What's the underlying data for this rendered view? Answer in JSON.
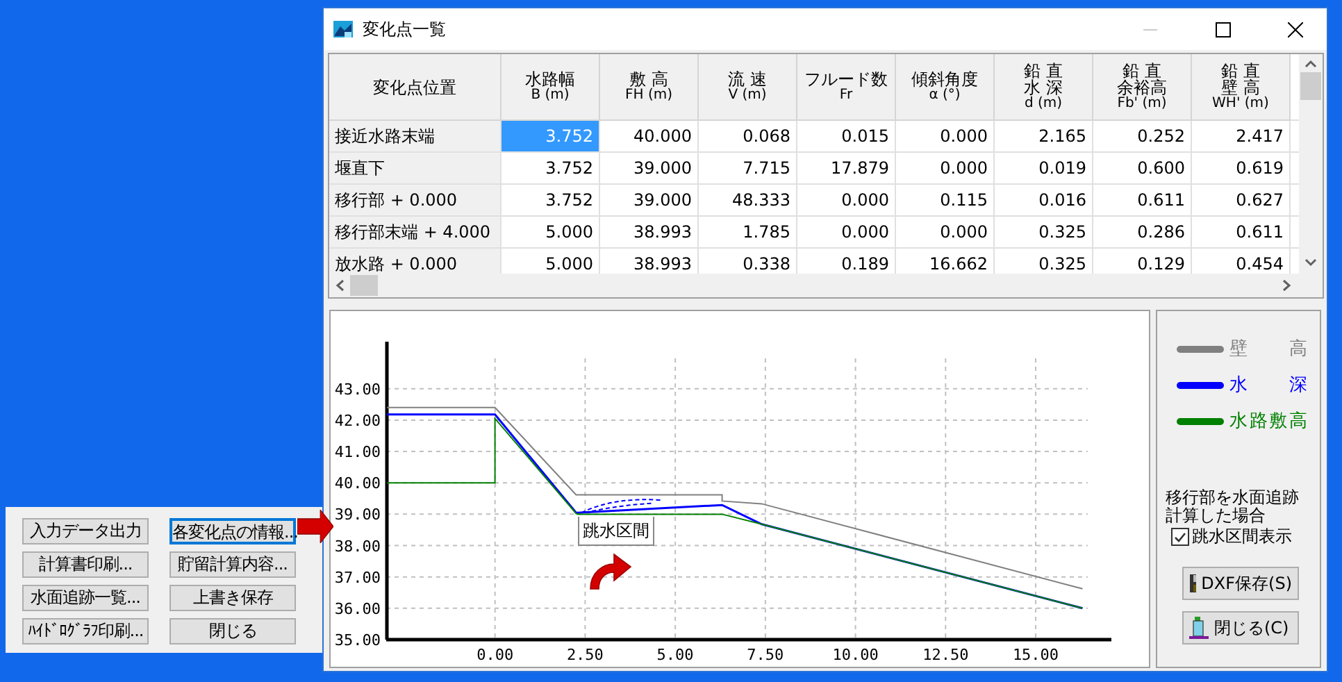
{
  "window": {
    "title": "変化点一覧"
  },
  "table": {
    "columns": [
      {
        "lines": [
          "変化点位置"
        ]
      },
      {
        "lines": [
          "水路幅",
          "B (m)"
        ]
      },
      {
        "lines": [
          "敷 高",
          "FH (m)"
        ]
      },
      {
        "lines": [
          "流 速",
          "V (m)"
        ]
      },
      {
        "lines": [
          "フルード数",
          "Fr"
        ]
      },
      {
        "lines": [
          "傾斜角度",
          "α (°)"
        ]
      },
      {
        "lines": [
          "鉛 直",
          "水 深",
          "d (m)"
        ]
      },
      {
        "lines": [
          "鉛 直",
          "余裕高",
          "Fb' (m)"
        ]
      },
      {
        "lines": [
          "鉛 直",
          "壁 高",
          "WH' (m)"
        ]
      }
    ],
    "rows": [
      {
        "cells": [
          {
            "text": "接近水路末端",
            "selected": false
          },
          {
            "text": "3.752",
            "selected": true
          },
          {
            "text": "40.000",
            "selected": false
          },
          {
            "text": "0.068",
            "selected": false
          },
          {
            "text": "0.015",
            "selected": false
          },
          {
            "text": "0.000",
            "selected": false
          },
          {
            "text": "2.165",
            "selected": false
          },
          {
            "text": "0.252",
            "selected": false
          },
          {
            "text": "2.417",
            "selected": false
          }
        ]
      },
      {
        "cells": [
          {
            "text": "堰直下",
            "selected": false
          },
          {
            "text": "3.752",
            "selected": false
          },
          {
            "text": "39.000",
            "selected": false
          },
          {
            "text": "7.715",
            "selected": false
          },
          {
            "text": "17.879",
            "selected": false
          },
          {
            "text": "0.000",
            "selected": false
          },
          {
            "text": "0.019",
            "selected": false
          },
          {
            "text": "0.600",
            "selected": false
          },
          {
            "text": "0.619",
            "selected": false
          }
        ]
      },
      {
        "cells": [
          {
            "text": "移行部 + 0.000",
            "selected": false
          },
          {
            "text": "3.752",
            "selected": false
          },
          {
            "text": "39.000",
            "selected": false
          },
          {
            "text": "48.333",
            "selected": false
          },
          {
            "text": "0.000",
            "selected": false
          },
          {
            "text": "0.115",
            "selected": false
          },
          {
            "text": "0.016",
            "selected": false
          },
          {
            "text": "0.611",
            "selected": false
          },
          {
            "text": "0.627",
            "selected": false
          }
        ]
      },
      {
        "cells": [
          {
            "text": "移行部末端 + 4.000",
            "selected": false
          },
          {
            "text": "5.000",
            "selected": false
          },
          {
            "text": "38.993",
            "selected": false
          },
          {
            "text": "1.785",
            "selected": false
          },
          {
            "text": "0.000",
            "selected": false
          },
          {
            "text": "0.000",
            "selected": false
          },
          {
            "text": "0.325",
            "selected": false
          },
          {
            "text": "0.286",
            "selected": false
          },
          {
            "text": "0.611",
            "selected": false
          }
        ]
      },
      {
        "cells": [
          {
            "text": "放水路 + 0.000",
            "selected": false
          },
          {
            "text": "5.000",
            "selected": false
          },
          {
            "text": "38.993",
            "selected": false
          },
          {
            "text": "0.338",
            "selected": false
          },
          {
            "text": "0.189",
            "selected": false
          },
          {
            "text": "16.662",
            "selected": false
          },
          {
            "text": "0.325",
            "selected": false
          },
          {
            "text": "0.129",
            "selected": false
          },
          {
            "text": "0.454",
            "selected": false
          }
        ]
      }
    ]
  },
  "chart": {
    "chart_data": {
      "type": "line",
      "grid": true,
      "xlim": [
        -3,
        17.1
      ],
      "ylim": [
        35,
        44.5
      ],
      "xticks": [
        {
          "value": 0,
          "label": "0.00"
        },
        {
          "value": 2.5,
          "label": "2.50"
        },
        {
          "value": 5,
          "label": "5.00"
        },
        {
          "value": 7.5,
          "label": "7.50"
        },
        {
          "value": 10,
          "label": "10.00"
        },
        {
          "value": 12.5,
          "label": "12.50"
        },
        {
          "value": 15,
          "label": "15.00"
        }
      ],
      "yticks": [
        {
          "value": 35,
          "label": "35.00"
        },
        {
          "value": 36,
          "label": "36.00"
        },
        {
          "value": 37,
          "label": "37.00"
        },
        {
          "value": 38,
          "label": "38.00"
        },
        {
          "value": 39,
          "label": "39.00"
        },
        {
          "value": 40,
          "label": "40.00"
        },
        {
          "value": 41,
          "label": "41.00"
        },
        {
          "value": 42,
          "label": "42.00"
        },
        {
          "value": 43,
          "label": "43.00"
        }
      ],
      "x": [
        -3,
        0,
        0,
        2.25,
        2.3,
        6.3,
        6.3,
        7.4,
        16.3
      ],
      "series": [
        {
          "name": "壁　高",
          "color": "#808080",
          "values": [
            42.4,
            42.4,
            42.4,
            39.62,
            39.62,
            39.62,
            39.42,
            39.33,
            36.62
          ]
        },
        {
          "name": "水　深",
          "color": "#0000ff",
          "values": [
            42.18,
            42.18,
            42.18,
            39.05,
            39.05,
            39.29,
            39.29,
            38.68,
            36.0
          ]
        },
        {
          "name": "水路敷高",
          "color": "#008000",
          "values": [
            40.0,
            40.0,
            42.05,
            39.02,
            39.0,
            39.0,
            39.0,
            38.68,
            36.0
          ]
        }
      ],
      "annotations": [
        "跳水区間"
      ]
    }
  },
  "options": {
    "note": "移行部を水面追跡計算した場合",
    "checkbox": {
      "label": "跳水区間表示",
      "checked": true
    }
  },
  "panel_buttons": [
    {
      "label": "DXF保存(S)",
      "kind": "save"
    },
    {
      "label": "閉じる(C)",
      "kind": "close"
    }
  ],
  "menu_buttons": [
    {
      "label": "入力データ出力",
      "focused": false
    },
    {
      "label": "各変化点の情報...",
      "focused": true
    },
    {
      "label": "計算書印刷...",
      "focused": false
    },
    {
      "label": "貯留計算内容...",
      "focused": false
    },
    {
      "label": "水面追跡一覧...",
      "focused": false
    },
    {
      "label": "上書き保存",
      "focused": false
    },
    {
      "label": "ﾊｲﾄﾞﾛｸﾞﾗﾌ印刷...",
      "focused": false
    },
    {
      "label": "閉じる",
      "focused": false
    }
  ]
}
